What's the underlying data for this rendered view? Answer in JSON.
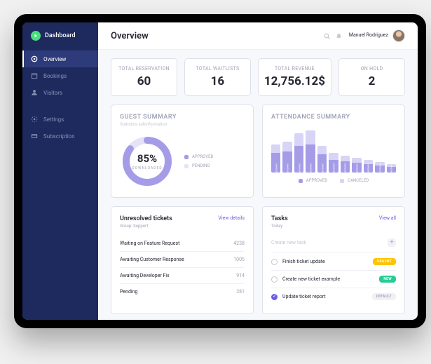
{
  "brand": {
    "name": "Dashboard"
  },
  "nav": [
    {
      "icon": "overview",
      "label": "Overview",
      "active": true
    },
    {
      "icon": "bookings",
      "label": "Bookings",
      "active": false
    },
    {
      "icon": "visitors",
      "label": "Visitors",
      "active": false
    },
    {
      "icon": "settings",
      "label": "Settings",
      "active": false
    },
    {
      "icon": "subscription",
      "label": "Subscription",
      "active": false
    }
  ],
  "header": {
    "title": "Overview",
    "user_name": "Manuel Rodriguez"
  },
  "stats": [
    {
      "label": "TOTAL RESERVATION",
      "value": "60"
    },
    {
      "label": "TOTAL WAITLISTS",
      "value": "16"
    },
    {
      "label": "TOTAL REVENUE",
      "value": "12,756.12$"
    },
    {
      "label": "ON HOLD",
      "value": "2"
    }
  ],
  "guest": {
    "title": "GUEST SUMMARY",
    "subtitle": "Statistics subinformation",
    "percent_label": "85%",
    "percent_value": 85,
    "downloaded_label": "DOWNLOADED",
    "legend": [
      {
        "label": "APPROVED",
        "color": "#a59ce8"
      },
      {
        "label": "PENDING",
        "color": "#e6e3f8"
      }
    ]
  },
  "attendance": {
    "title": "ATTENDANCE SUMMARY",
    "legend": [
      {
        "label": "APPROVED",
        "color": "#a59ce8"
      },
      {
        "label": "CANCELED",
        "color": "#d7d4f5"
      }
    ]
  },
  "chart_data": {
    "type": "bar",
    "categories": [
      "answer",
      "answer",
      "answer",
      "answer",
      "answer",
      "answer",
      "answer",
      "answer",
      "answer",
      "answer",
      "answer"
    ],
    "series": [
      {
        "name": "APPROVED",
        "values": [
          28,
          30,
          38,
          40,
          26,
          18,
          16,
          14,
          12,
          10,
          8
        ]
      },
      {
        "name": "CANCELED",
        "values": [
          12,
          14,
          18,
          20,
          12,
          10,
          8,
          7,
          6,
          5,
          4
        ]
      }
    ],
    "ylim": [
      0,
      60
    ]
  },
  "tickets": {
    "title": "Unresolved tickets",
    "link": "View details",
    "meta_label": "Group:",
    "meta_value": "Support",
    "rows": [
      {
        "name": "Waiting on Feature Request",
        "count": "4238"
      },
      {
        "name": "Awaiting Customer Response",
        "count": "1005"
      },
      {
        "name": "Awaiting Developer Fix",
        "count": "914"
      },
      {
        "name": "Pending",
        "count": "281"
      }
    ]
  },
  "tasks": {
    "title": "Tasks",
    "link": "View all",
    "meta": "Today",
    "create_placeholder": "Create new task",
    "rows": [
      {
        "done": false,
        "name": "Finish ticket update",
        "badge": "URGENT",
        "badge_class": "urgent"
      },
      {
        "done": false,
        "name": "Create new ticket example",
        "badge": "NEW",
        "badge_class": "new"
      },
      {
        "done": true,
        "name": "Update ticket report",
        "badge": "DEFAULT",
        "badge_class": "default"
      }
    ]
  }
}
